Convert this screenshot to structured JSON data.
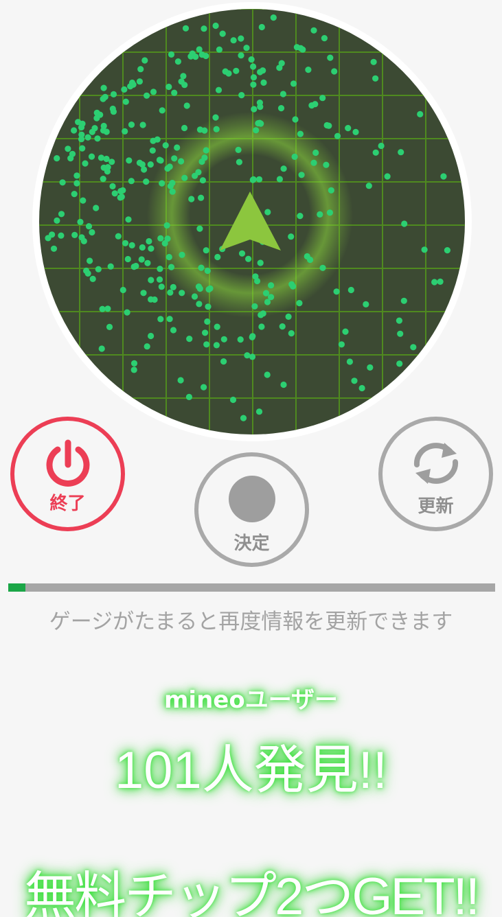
{
  "radar": {
    "background": "#3c4a33",
    "grid_color": "#4f8a1f",
    "ring_color": "#8bd63c",
    "arrow_color": "#8cc63e",
    "dot_color": "#2ccf72",
    "icons": [
      "compass-arrow-icon"
    ]
  },
  "buttons": {
    "end": {
      "label": "終了",
      "icon": "power-icon",
      "color": "#ec3e55"
    },
    "decide": {
      "label": "決定",
      "icon": "circle-icon",
      "color": "#a9a9a9"
    },
    "refresh": {
      "label": "更新",
      "icon": "refresh-icon",
      "color": "#a9a9a9"
    }
  },
  "gauge": {
    "progress": 0.035,
    "note": "ゲージがたまると再度情報を更新できます"
  },
  "result": {
    "subtitle": "mineoユーザー",
    "found": "101人発見!!",
    "prize": "無料チップ2つGET!!",
    "glow_color": "#39e23a"
  }
}
